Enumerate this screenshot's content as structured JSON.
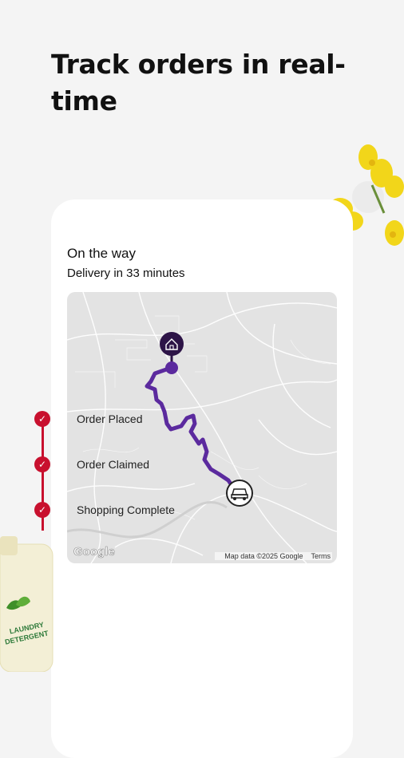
{
  "headline": "Track orders in real-time",
  "tracking": {
    "status_title": "On the way",
    "eta": "Delivery in 33 minutes"
  },
  "map": {
    "attribution": "Google",
    "map_data": "Map data ©2025 Google",
    "terms": "Terms",
    "route_color": "#5b2a9e",
    "home_pin_icon": "home-icon",
    "vehicle_icon": "car-icon"
  },
  "decoration": {
    "bottle_label": "LAUNDRY DETERGENT"
  },
  "timeline": [
    {
      "label": "Order Placed",
      "icon": "check-icon"
    },
    {
      "label": "Order Claimed",
      "icon": "check-icon"
    },
    {
      "label": "Shopping Complete",
      "icon": "check-icon"
    }
  ],
  "colors": {
    "accent": "#c8102e",
    "route": "#5b2a9e",
    "background": "#f4f4f4"
  }
}
